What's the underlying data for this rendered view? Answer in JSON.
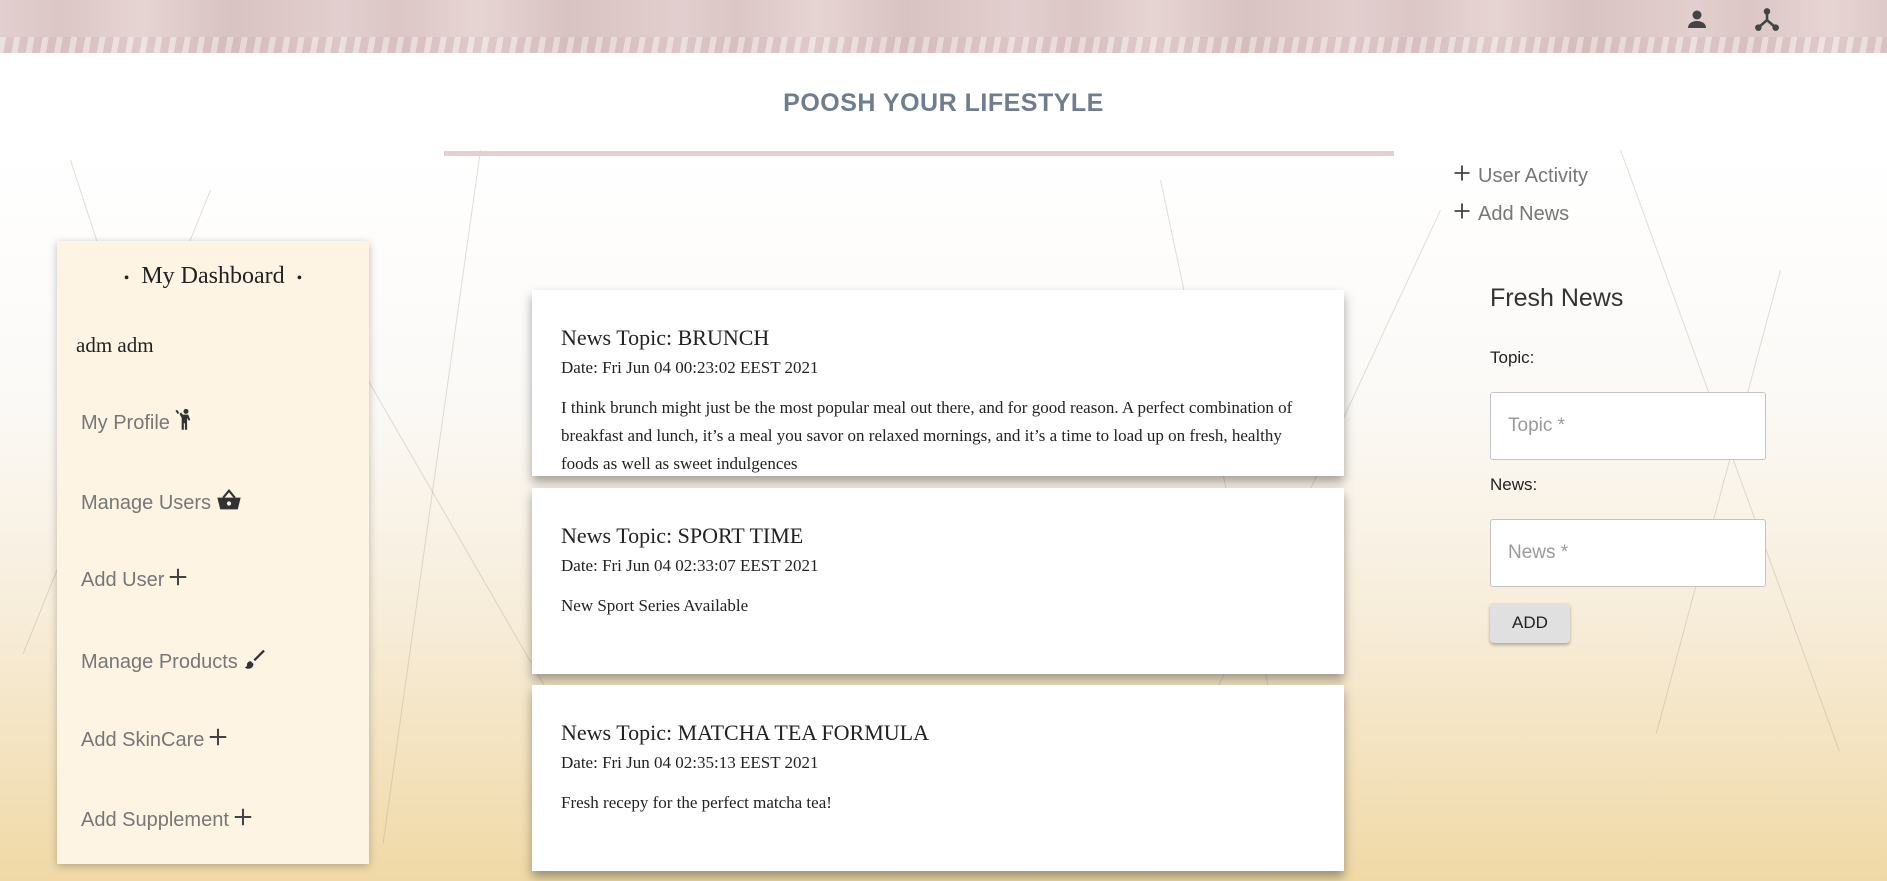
{
  "header": {
    "brand": "POOSH YOUR LIFESTYLE",
    "icons": [
      "person-icon",
      "hierarchy-icon"
    ]
  },
  "sidebar": {
    "title": "My Dashboard",
    "user": "adm adm",
    "items": [
      {
        "label": "My Profile",
        "icon": "person-waving-icon"
      },
      {
        "label": "Manage Users",
        "icon": "basket-icon"
      },
      {
        "label": "Add User",
        "icon": "plus-icon"
      },
      {
        "label": "Manage Products",
        "icon": "brush-icon"
      },
      {
        "label": "Add SkinCare",
        "icon": "plus-icon"
      },
      {
        "label": "Add Supplement",
        "icon": "plus-icon"
      }
    ]
  },
  "news": [
    {
      "topic": "News Topic: BRUNCH",
      "date": "Date: Fri Jun 04 00:23:02 EEST 2021",
      "body": "I think brunch might just be the most popular meal out there, and for good reason. A perfect combination of breakfast and lunch, it’s a meal you savor on relaxed mornings, and it’s a time to load up on fresh, healthy foods as well as sweet indulgences"
    },
    {
      "topic": "News Topic: SPORT TIME",
      "date": "Date: Fri Jun 04 02:33:07 EEST 2021",
      "body": "New Sport Series Available"
    },
    {
      "topic": "News Topic: MATCHA TEA FORMULA",
      "date": "Date: Fri Jun 04 02:35:13 EEST 2021",
      "body": "Fresh recepy for the perfect matcha tea!"
    }
  ],
  "right_links": {
    "user_activity": "User Activity",
    "add_news": "Add News"
  },
  "form": {
    "title": "Fresh News",
    "topic_label": "Topic:",
    "topic_placeholder": "Topic *",
    "news_label": "News:",
    "news_placeholder": "News *",
    "add_button": "ADD"
  },
  "colors": {
    "brand": "#6f7d8f",
    "sidebar_bg": "#fdf4e4",
    "topbar": "#e3cfcf"
  }
}
